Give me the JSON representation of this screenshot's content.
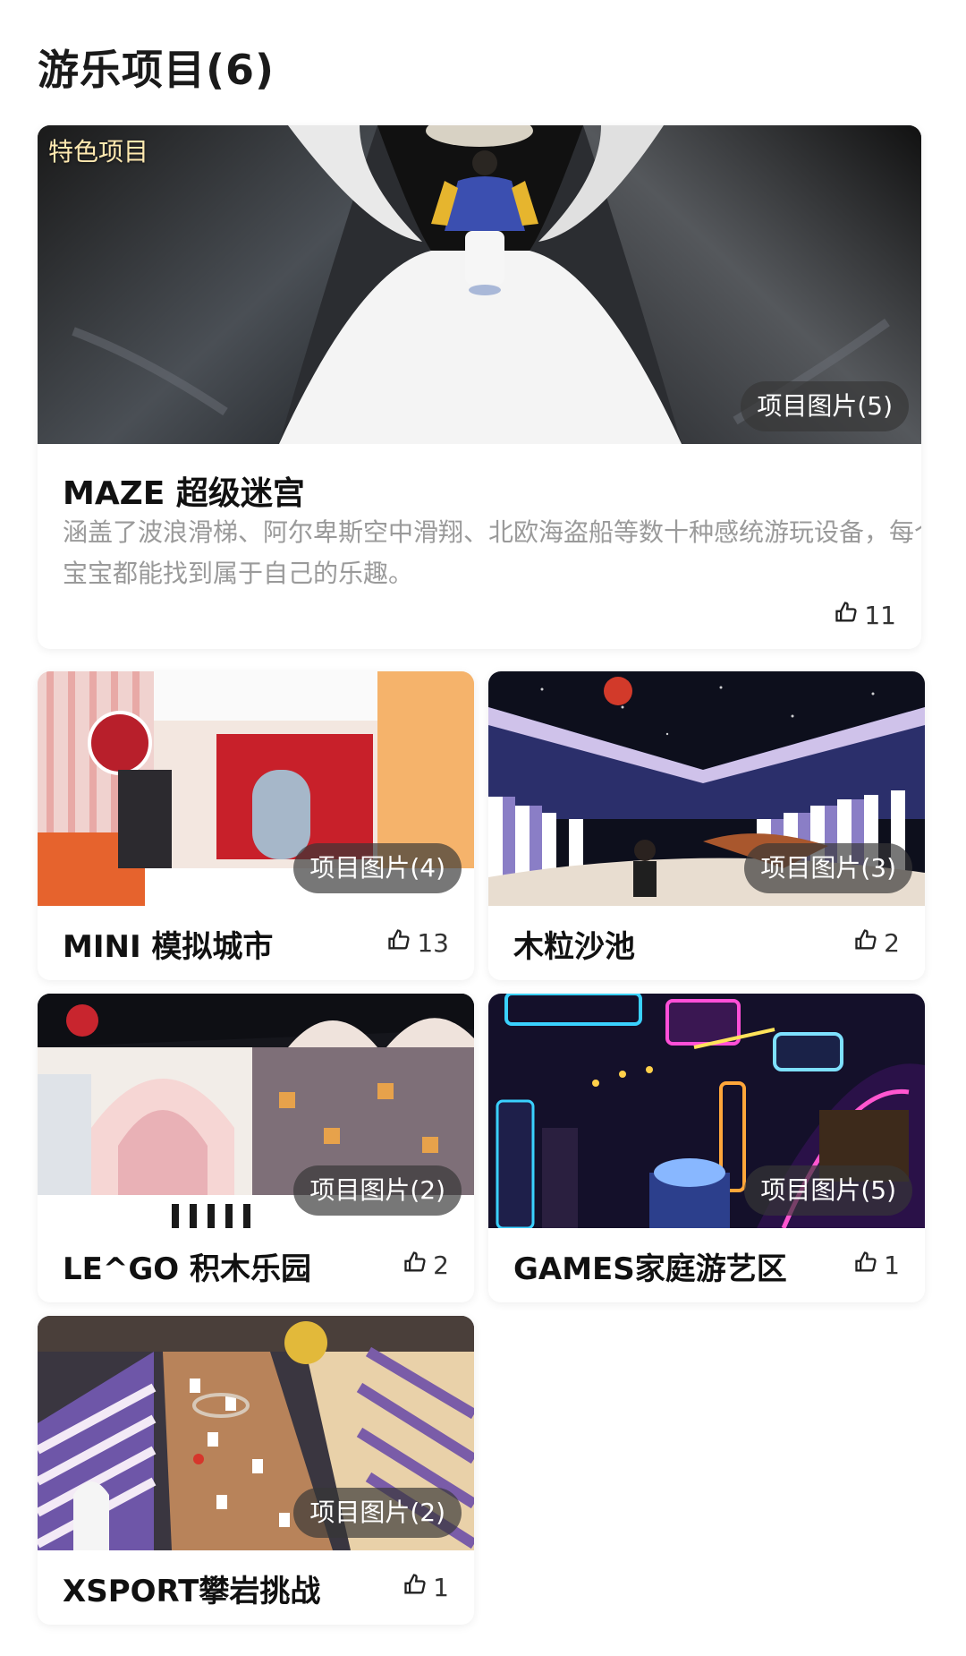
{
  "section": {
    "title": "游乐项目(6)"
  },
  "featured": {
    "tag": "特色项目",
    "photos_label": "项目图片(5)",
    "title": "MAZE 超级迷宫",
    "description": "涵盖了波浪滑梯、阿尔卑斯空中滑翔、北欧海盗船等数十种感统游玩设备，每个宝宝都能找到属于自己的乐趣。",
    "likes": "11"
  },
  "items": [
    {
      "title": "MINI 模拟城市",
      "photos_label": "项目图片(4)",
      "likes": "13"
    },
    {
      "title": "木粒沙池",
      "photos_label": "项目图片(3)",
      "likes": "2"
    },
    {
      "title": "LE^GO 积木乐园",
      "photos_label": "项目图片(2)",
      "likes": "2"
    },
    {
      "title": "GAMES家庭游艺区",
      "photos_label": "项目图片(5)",
      "likes": "1"
    },
    {
      "title": "XSPORT攀岩挑战",
      "photos_label": "项目图片(2)",
      "likes": "1"
    }
  ],
  "icons": {
    "like": "thumbs-up-icon"
  }
}
